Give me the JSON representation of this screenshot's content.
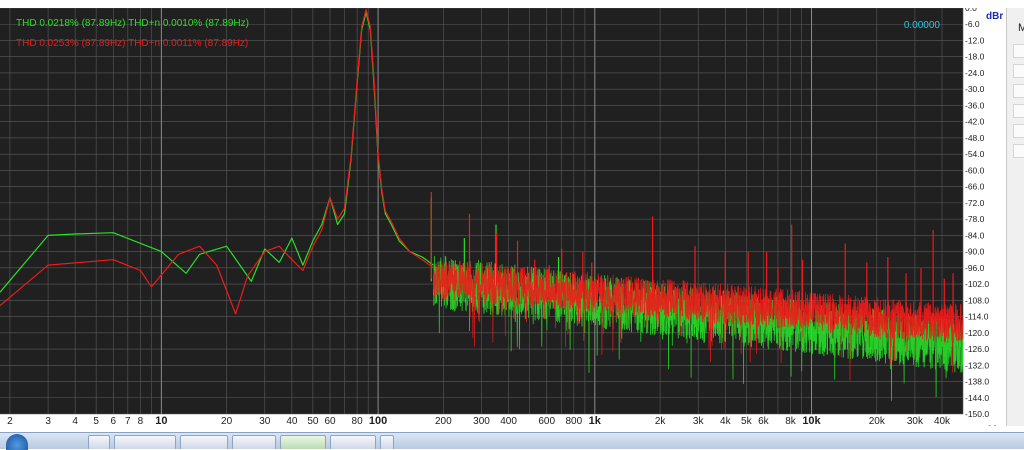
{
  "chart_data": {
    "type": "line",
    "title": "",
    "xlabel": "",
    "ylabel": "",
    "x_unit": "Hz",
    "y_unit": "dBr",
    "x_scale": "log",
    "xlim": [
      1.8,
      50000
    ],
    "ylim": [
      -150,
      0
    ],
    "grid": true,
    "background": "#202020",
    "readout": "0.00000",
    "y_ticks": [
      {
        "v": 0,
        "label": "0.0"
      },
      {
        "v": -6,
        "label": "-6.0"
      },
      {
        "v": -12,
        "label": "-12.0"
      },
      {
        "v": -18,
        "label": "-18.0"
      },
      {
        "v": -24,
        "label": "-24.0"
      },
      {
        "v": -30,
        "label": "-30.0"
      },
      {
        "v": -36,
        "label": "-36.0"
      },
      {
        "v": -42,
        "label": "-42.0"
      },
      {
        "v": -48,
        "label": "-48.0"
      },
      {
        "v": -54,
        "label": "-54.0"
      },
      {
        "v": -60,
        "label": "-60.0"
      },
      {
        "v": -66,
        "label": "-66.0"
      },
      {
        "v": -72,
        "label": "-72.0"
      },
      {
        "v": -78,
        "label": "-78.0"
      },
      {
        "v": -84,
        "label": "-84.0"
      },
      {
        "v": -90,
        "label": "-90.0"
      },
      {
        "v": -96,
        "label": "-96.0"
      },
      {
        "v": -102,
        "label": "-102.0"
      },
      {
        "v": -108,
        "label": "-108.0"
      },
      {
        "v": -114,
        "label": "-114.0"
      },
      {
        "v": -120,
        "label": "-120.0"
      },
      {
        "v": -126,
        "label": "-126.0"
      },
      {
        "v": -132,
        "label": "-132.0"
      },
      {
        "v": -138,
        "label": "-138.0"
      },
      {
        "v": -144,
        "label": "-144.0"
      },
      {
        "v": -150,
        "label": "-150.0"
      }
    ],
    "x_ticks": [
      {
        "v": 2,
        "label": "2",
        "bold": false
      },
      {
        "v": 3,
        "label": "3",
        "bold": false
      },
      {
        "v": 4,
        "label": "4",
        "bold": false
      },
      {
        "v": 5,
        "label": "5",
        "bold": false
      },
      {
        "v": 6,
        "label": "6",
        "bold": false
      },
      {
        "v": 7,
        "label": "7",
        "bold": false
      },
      {
        "v": 8,
        "label": "8",
        "bold": false
      },
      {
        "v": 10,
        "label": "10",
        "bold": true
      },
      {
        "v": 20,
        "label": "20",
        "bold": false
      },
      {
        "v": 30,
        "label": "30",
        "bold": false
      },
      {
        "v": 40,
        "label": "40",
        "bold": false
      },
      {
        "v": 50,
        "label": "50",
        "bold": false
      },
      {
        "v": 60,
        "label": "60",
        "bold": false
      },
      {
        "v": 80,
        "label": "80",
        "bold": false
      },
      {
        "v": 100,
        "label": "100",
        "bold": true
      },
      {
        "v": 200,
        "label": "200",
        "bold": false
      },
      {
        "v": 300,
        "label": "300",
        "bold": false
      },
      {
        "v": 400,
        "label": "400",
        "bold": false
      },
      {
        "v": 600,
        "label": "600",
        "bold": false
      },
      {
        "v": 800,
        "label": "800",
        "bold": false
      },
      {
        "v": 1000,
        "label": "1k",
        "bold": true
      },
      {
        "v": 2000,
        "label": "2k",
        "bold": false
      },
      {
        "v": 3000,
        "label": "3k",
        "bold": false
      },
      {
        "v": 4000,
        "label": "4k",
        "bold": false
      },
      {
        "v": 5000,
        "label": "5k",
        "bold": false
      },
      {
        "v": 6000,
        "label": "6k",
        "bold": false
      },
      {
        "v": 8000,
        "label": "8k",
        "bold": false
      },
      {
        "v": 10000,
        "label": "10k",
        "bold": true
      },
      {
        "v": 20000,
        "label": "20k",
        "bold": false
      },
      {
        "v": 30000,
        "label": "30k",
        "bold": false
      },
      {
        "v": 40000,
        "label": "40k",
        "bold": false
      }
    ],
    "series": [
      {
        "name": "THD 0.0218% (87.89Hz) THD+n 0.0010% (87.89Hz)",
        "color": "#27e027",
        "points": [
          [
            1.8,
            -105
          ],
          [
            3,
            -84
          ],
          [
            4,
            -83.5
          ],
          [
            6,
            -83
          ],
          [
            10,
            -90
          ],
          [
            13,
            -98
          ],
          [
            15,
            -91
          ],
          [
            20,
            -88
          ],
          [
            26,
            -101
          ],
          [
            30,
            -89
          ],
          [
            35,
            -94
          ],
          [
            40,
            -85
          ],
          [
            45,
            -95
          ],
          [
            50,
            -86
          ],
          [
            55,
            -80
          ],
          [
            60,
            -70
          ],
          [
            65,
            -80
          ],
          [
            70,
            -76
          ],
          [
            75,
            -56
          ],
          [
            80,
            -28
          ],
          [
            84,
            -8
          ],
          [
            88,
            -1.5
          ],
          [
            92,
            -8
          ],
          [
            96,
            -30
          ],
          [
            100,
            -55
          ],
          [
            104,
            -68
          ],
          [
            108,
            -76
          ],
          [
            115,
            -80
          ],
          [
            125,
            -86
          ],
          [
            140,
            -90
          ],
          [
            160,
            -92
          ],
          [
            180,
            -95
          ]
        ],
        "floor": {
          "from": 180,
          "to": 50000,
          "level_start": -101,
          "level_end": -125,
          "spread": 20,
          "seed": 7
        },
        "spurs": [
          [
            176,
            -70
          ],
          [
            250,
            -85
          ],
          [
            350,
            -80
          ],
          [
            520,
            -96
          ],
          [
            680,
            -92
          ],
          [
            1300,
            -104
          ],
          [
            1750,
            -108
          ]
        ]
      },
      {
        "name": "THD 0.0253% (87.89Hz) THD+n 0.0011% (87.89Hz)",
        "color": "#f01a1a",
        "points": [
          [
            1.8,
            -110
          ],
          [
            3,
            -95
          ],
          [
            6,
            -93
          ],
          [
            8,
            -97
          ],
          [
            9,
            -103
          ],
          [
            12,
            -91
          ],
          [
            15,
            -88
          ],
          [
            18,
            -95
          ],
          [
            22,
            -113
          ],
          [
            25,
            -99
          ],
          [
            30,
            -90
          ],
          [
            35,
            -88
          ],
          [
            40,
            -93
          ],
          [
            45,
            -97
          ],
          [
            50,
            -88
          ],
          [
            55,
            -82
          ],
          [
            60,
            -70
          ],
          [
            65,
            -78
          ],
          [
            70,
            -74
          ],
          [
            75,
            -55
          ],
          [
            80,
            -27
          ],
          [
            84,
            -7
          ],
          [
            88,
            -0.5
          ],
          [
            92,
            -7
          ],
          [
            96,
            -28
          ],
          [
            100,
            -54
          ],
          [
            104,
            -67
          ],
          [
            108,
            -75
          ],
          [
            115,
            -79
          ],
          [
            125,
            -85
          ],
          [
            140,
            -90
          ],
          [
            160,
            -93
          ],
          [
            180,
            -96
          ]
        ],
        "floor": {
          "from": 180,
          "to": 50000,
          "level_start": -100,
          "level_end": -117,
          "spread": 15,
          "seed": 3
        },
        "spurs": [
          [
            176,
            -68
          ],
          [
            264,
            -76
          ],
          [
            352,
            -83
          ],
          [
            440,
            -86
          ],
          [
            528,
            -93
          ],
          [
            616,
            -95
          ],
          [
            704,
            -89
          ],
          [
            880,
            -90
          ],
          [
            968,
            -94
          ],
          [
            1848,
            -77
          ],
          [
            2900,
            -88
          ],
          [
            4000,
            -90
          ],
          [
            5100,
            -90
          ],
          [
            6200,
            -90
          ],
          [
            7000,
            -96
          ],
          [
            8100,
            -80
          ],
          [
            9100,
            -93
          ],
          [
            14300,
            -87
          ],
          [
            18000,
            -94
          ],
          [
            22500,
            -92
          ],
          [
            27300,
            -98
          ],
          [
            32000,
            -96
          ],
          [
            36400,
            -82
          ],
          [
            41000,
            -100
          ],
          [
            45000,
            -98
          ]
        ]
      }
    ]
  },
  "taskbar": {}
}
